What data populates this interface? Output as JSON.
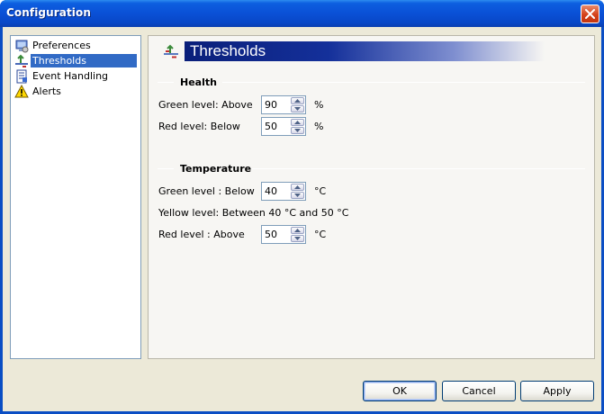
{
  "window": {
    "title": "Configuration",
    "close_icon": "close-icon"
  },
  "nav": {
    "items": [
      {
        "label": "Preferences",
        "icon": "preferences-icon"
      },
      {
        "label": "Thresholds",
        "icon": "thresholds-icon",
        "selected": true
      },
      {
        "label": "Event Handling",
        "icon": "event-handling-icon"
      },
      {
        "label": "Alerts",
        "icon": "warning-icon"
      }
    ]
  },
  "panel": {
    "title": "Thresholds",
    "icon": "thresholds-icon"
  },
  "health": {
    "section_title": "Health",
    "green_label": "Green level: Above",
    "green_value": "90",
    "green_unit": "%",
    "red_label": "Red level: Below",
    "red_value": "50",
    "red_unit": "%"
  },
  "temperature": {
    "section_title": "Temperature",
    "green_label": "Green level : Below",
    "green_value": "40",
    "green_unit": "°C",
    "yellow_text": "Yellow level: Between 40 °C and 50 °C",
    "red_label": "Red level : Above",
    "red_value": "50",
    "red_unit": "°C"
  },
  "buttons": {
    "ok": "OK",
    "cancel": "Cancel",
    "apply": "Apply"
  },
  "colors": {
    "titlebar": "#0a50d6",
    "selection": "#316ac5",
    "header_bar": "#0a1f7a"
  }
}
